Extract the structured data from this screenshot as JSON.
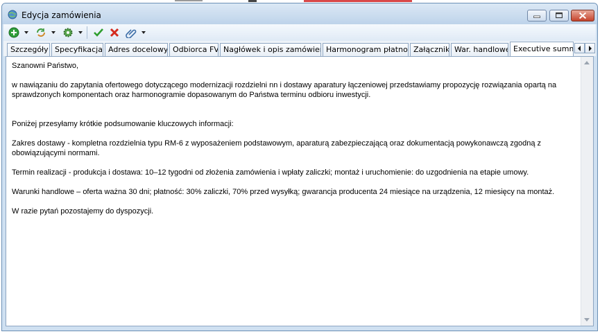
{
  "window": {
    "title": "Edycja zamówienia"
  },
  "toolbar": {
    "buttons": [
      {
        "icon": "add-icon"
      },
      {
        "icon": "refresh-icon"
      },
      {
        "icon": "settings-gear-icon"
      },
      {
        "icon": "accept-check-icon"
      },
      {
        "icon": "reject-x-icon"
      },
      {
        "icon": "attachment-clip-icon"
      }
    ]
  },
  "tabs": [
    {
      "label": "Szczegóły"
    },
    {
      "label": "Specyfikacja"
    },
    {
      "label": "Adres docelowy"
    },
    {
      "label": "Odbiorca FV"
    },
    {
      "label": "Nagłówek i opis zamówienia"
    },
    {
      "label": "Harmonogram płatności"
    },
    {
      "label": "Załączniki"
    },
    {
      "label": "War. handlowe"
    },
    {
      "label": "Executive summa",
      "active": true
    }
  ],
  "content": {
    "paragraphs": [
      "Szanowni Państwo,",
      "w nawiązaniu do zapytania ofertowego dotyczącego modernizacji rozdzielni nn i dostawy aparatury łączeniowej przedstawiamy propozycję rozwiązania opartą na sprawdzonych komponentach oraz harmonogramie dopasowanym do Państwa terminu odbioru inwestycji.",
      "Poniżej przesyłamy krótkie podsumowanie kluczowych informacji:",
      "Zakres dostawy - kompletna rozdzielnia typu RM-6 z wyposażeniem podstawowym, aparaturą zabezpieczającą oraz dokumentacją powykonawczą zgodną z obowiązującymi normami.",
      "Termin realizacji - produkcja i dostawa: 10–12 tygodni od złożenia zamówienia i wpłaty zaliczki; montaż i uruchomienie: do uzgodnienia na etapie umowy.",
      "Warunki handlowe – oferta ważna 30 dni; płatność: 30% zaliczki, 70% przed wysyłką; gwarancja producenta 24 miesiące na urządzenia, 12 miesięcy na montaż.",
      "W razie pytań pozostajemy do dyspozycji."
    ]
  },
  "colors": {
    "window_frame": "#6b8fb5",
    "title_bg": "#cfe0f1",
    "close_button": "#c5432c"
  }
}
